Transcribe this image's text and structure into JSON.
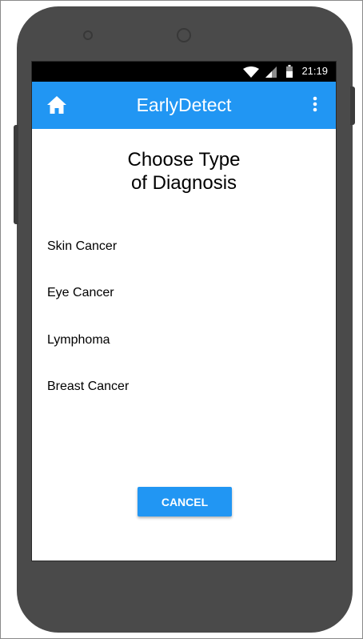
{
  "status_bar": {
    "time": "21:19"
  },
  "app_bar": {
    "title": "EarlyDetect",
    "home_icon": "home-icon",
    "menu_icon": "more-vert-icon"
  },
  "page": {
    "heading_line1": "Choose Type",
    "heading_line2": "of Diagnosis",
    "options": [
      {
        "label": "Skin Cancer"
      },
      {
        "label": "Eye Cancer"
      },
      {
        "label": "Lymphoma"
      },
      {
        "label": "Breast Cancer"
      }
    ],
    "cancel_label": "CANCEL"
  },
  "colors": {
    "primary": "#2196f3",
    "device": "#4a4a4a",
    "status_bar": "#000000"
  }
}
